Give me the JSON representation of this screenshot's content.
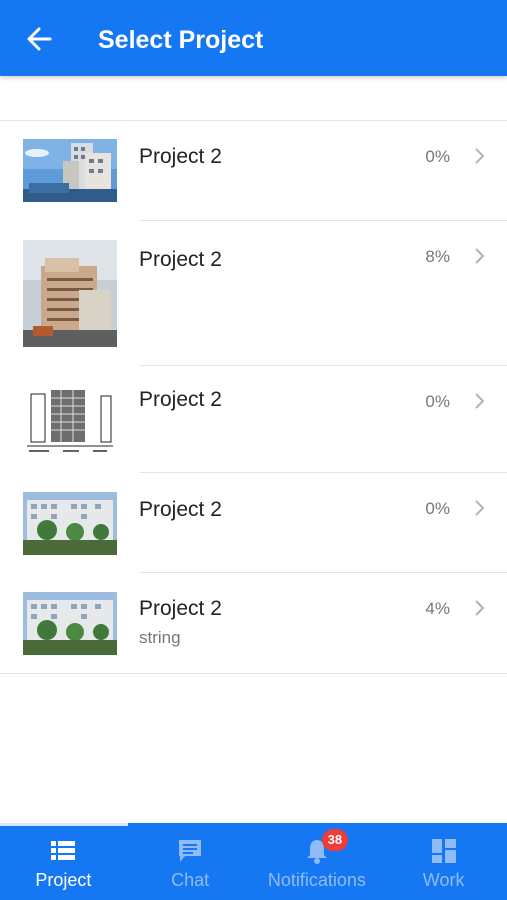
{
  "header": {
    "title": "Select Project"
  },
  "projects": [
    {
      "name": "Project 2",
      "progress": "0%",
      "subtitle": ""
    },
    {
      "name": "Project 2",
      "progress": "8%",
      "subtitle": ""
    },
    {
      "name": "Project 2",
      "progress": "0%",
      "subtitle": ""
    },
    {
      "name": "Project 2",
      "progress": "0%",
      "subtitle": ""
    },
    {
      "name": "Project 2",
      "progress": "4%",
      "subtitle": "string"
    }
  ],
  "nav": {
    "tabs": [
      {
        "label": "Project",
        "icon": "list-icon",
        "active": true
      },
      {
        "label": "Chat",
        "icon": "chat-icon",
        "active": false
      },
      {
        "label": "Notifications",
        "icon": "bell-icon",
        "active": false,
        "badge": "38"
      },
      {
        "label": "Work",
        "icon": "grid-icon",
        "active": false
      }
    ]
  },
  "colors": {
    "primary": "#1677f2",
    "badge": "#f03b3b",
    "inactive_tab": "#8fbcf8"
  }
}
